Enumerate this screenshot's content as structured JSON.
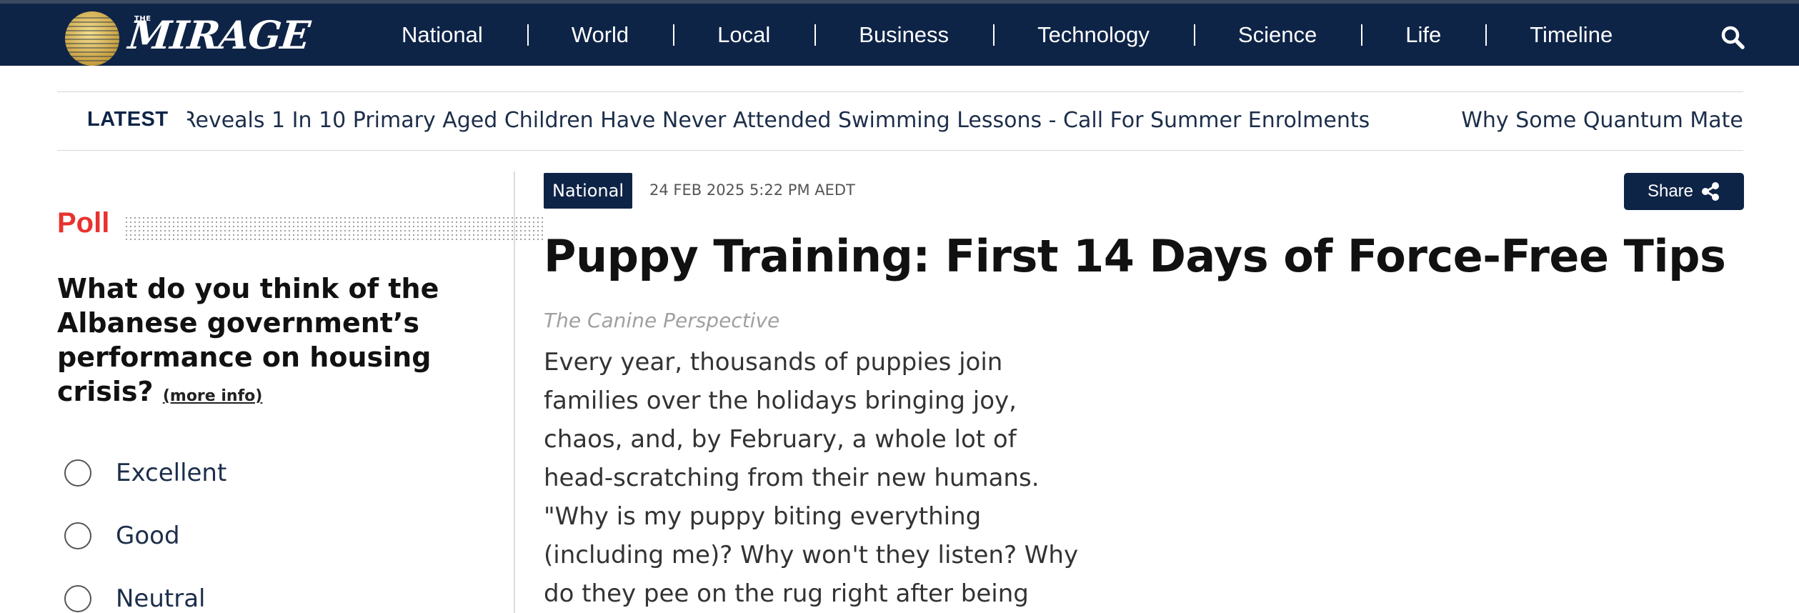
{
  "brand": {
    "the": "THE",
    "name": "MIRAGE"
  },
  "nav": {
    "items": [
      {
        "label": "National"
      },
      {
        "label": "World"
      },
      {
        "label": "Local"
      },
      {
        "label": "Business"
      },
      {
        "label": "Technology"
      },
      {
        "label": "Science"
      },
      {
        "label": "Life"
      },
      {
        "label": "Timeline"
      }
    ]
  },
  "ticker": {
    "label": "LATEST",
    "items": [
      "Reveals 1 In 10 Primary Aged Children Have Never Attended Swimming Lessons - Call For Summer Enrolments",
      "Why Some Quantum Materia"
    ]
  },
  "poll": {
    "title": "Poll",
    "question": "What do you think of the Albanese government’s performance on housing crisis?",
    "more_info": "(more info)",
    "options": [
      {
        "label": "Excellent"
      },
      {
        "label": "Good"
      },
      {
        "label": "Neutral"
      }
    ]
  },
  "article": {
    "category": "National",
    "date": "24 FEB 2025 5:22 PM AEDT",
    "share_label": "Share",
    "headline": "Puppy Training: First 14 Days of Force-Free Tips",
    "source": "The Canine Perspective",
    "lead": "Every year, thousands of puppies join families over the holidays bringing joy, chaos, and, by February, a whole lot of head-scratching from their new humans. \"Why is my puppy biting everything (including me)? Why won't they listen? Why do they pee on the rug right after being"
  },
  "colors": {
    "nav_bg": "#0e2447",
    "poll_accent": "#e8322f",
    "logo_gold": "#d9b957"
  }
}
